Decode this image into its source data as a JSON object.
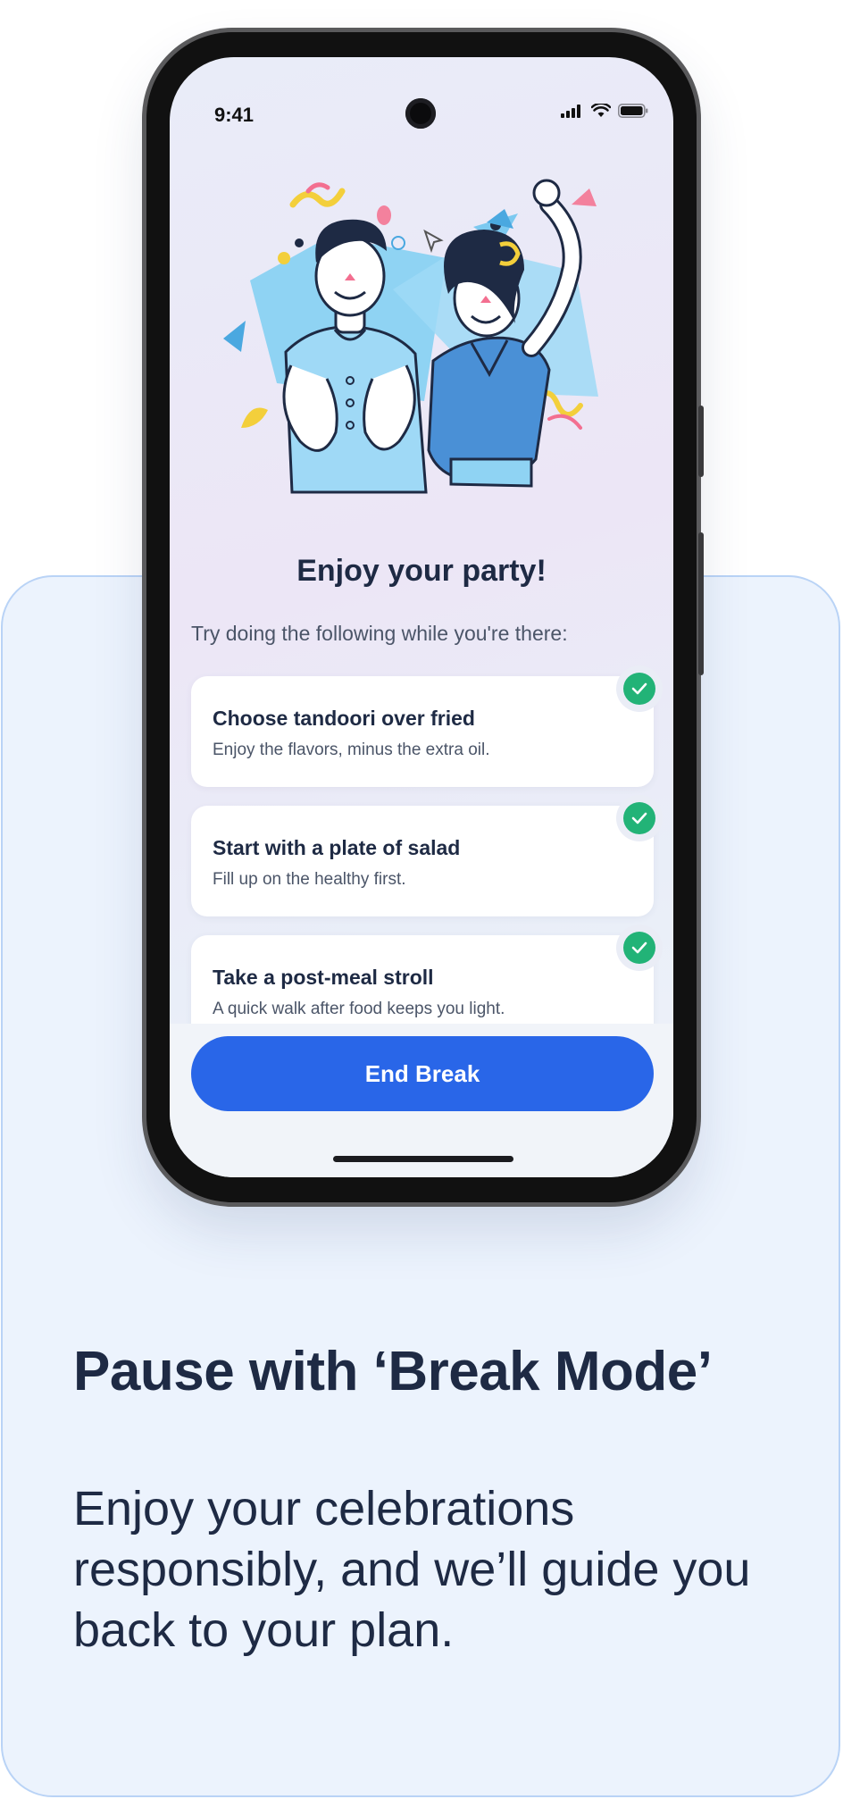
{
  "promo": {
    "title": "Pause with ‘Break Mode’",
    "body": "Enjoy your celebrations responsibly, and we’ll guide you back to your plan."
  },
  "status_bar": {
    "time": "9:41",
    "icons": [
      "signal-icon",
      "wifi-icon",
      "battery-icon"
    ]
  },
  "screen": {
    "title": "Enjoy your party!",
    "subtitle": "Try doing the following while you're there:",
    "tips": [
      {
        "title": "Choose tandoori over fried",
        "desc": "Enjoy the flavors, minus the extra oil.",
        "checked": true
      },
      {
        "title": "Start with a plate of salad",
        "desc": "Fill up on the healthy first.",
        "checked": true
      },
      {
        "title": "Take a post-meal stroll",
        "desc": "A quick walk after food keeps you light.",
        "checked": true
      }
    ],
    "end_button": "End Break"
  },
  "colors": {
    "accent": "#2966e8",
    "check": "#22b377",
    "text_dark": "#1e2a44",
    "card_bg": "#ecf3fd",
    "card_border": "#b9d3f6"
  }
}
